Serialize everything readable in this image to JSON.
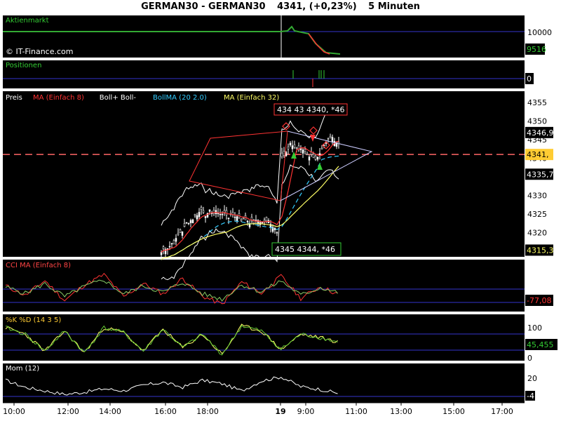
{
  "header": {
    "symbol": "GERMAN30 - GERMAN30",
    "price": "4341, (+0,23%)",
    "interval": "5 Minuten"
  },
  "panels": {
    "market": {
      "label": "Aktienmarkt",
      "copyright": "© IT-Finance.com",
      "level_label": "10000",
      "value_label": "9516"
    },
    "positions": {
      "label": "Positionen",
      "value_label": "0"
    },
    "price": {
      "legend": [
        {
          "text": "Preis",
          "color": "#ffffff"
        },
        {
          "text": "MA (Einfach 8)",
          "color": "#ff3333"
        },
        {
          "text": "Boll+ Boll-",
          "color": "#ffffff"
        },
        {
          "text": "BollMA (20 2.0)",
          "color": "#33ccff"
        },
        {
          "text": "MA (Einfach 32)",
          "color": "#ffff66"
        }
      ],
      "ticks": [
        "4355",
        "4350",
        "4345",
        "4340",
        "4335",
        "4330",
        "4325",
        "4320"
      ],
      "last_labels": [
        "4346,9",
        "4341,",
        "4335,7",
        "4315,3"
      ],
      "top_box": "434 43 4340, *46",
      "bottom_box": "4345 4344, *46"
    },
    "cci": {
      "label": "CCI MA (Einfach 8)",
      "value_label": "-77,08"
    },
    "stoch": {
      "label": "%K %D (14 3 5)",
      "ticks": [
        "100",
        "0"
      ],
      "value_label": "45,455"
    },
    "mom": {
      "label": "Mom (12)",
      "ticks": [
        "20"
      ],
      "value_label": "-4"
    }
  },
  "xaxis": {
    "labels": [
      "10:00",
      "12:00",
      "14:00",
      "16:00",
      "18:00",
      "19",
      "9:00",
      "11:00",
      "13:00",
      "15:00",
      "17:00"
    ]
  },
  "colors": {
    "background": "#000000",
    "grid_line": "#3333cc",
    "candle_up": "#ffffff",
    "ma8": "#ff3333",
    "ma32": "#ffff66",
    "bollma": "#33ccff",
    "current_line": "#ff6666",
    "market_line": "#33aa33"
  },
  "chart_data": [
    {
      "type": "line",
      "title": "Aktienmarkt",
      "series": [
        {
          "values": [
            10000,
            10000,
            10000,
            10020,
            10000,
            9516
          ]
        }
      ]
    },
    {
      "type": "line",
      "title": "Preis",
      "ylim": [
        4315,
        4357
      ],
      "series": [
        {
          "name": "Preis",
          "values": [
            4315.3,
            4322,
            4330,
            4340,
            4348,
            4342,
            4338,
            4341,
            4340,
            4338,
            4336,
            4337,
            4349,
            4344,
            4339,
            4347,
            4342,
            4341
          ]
        },
        {
          "name": "MA (Einfach 8)",
          "values": [
            4316,
            4320,
            4328,
            4336,
            4342,
            4341,
            4339,
            4340,
            4340,
            4339,
            4337,
            4338,
            4343,
            4344,
            4341,
            4344,
            4343,
            4341
          ]
        },
        {
          "name": "MA (Einfach 32)",
          "values": [
            4310,
            4313,
            4318,
            4326,
            4333,
            4337,
            4338,
            4339,
            4339,
            4339,
            4338,
            4338,
            4340,
            4341,
            4341,
            4342,
            4342,
            4341
          ]
        }
      ]
    },
    {
      "type": "line",
      "title": "CCI MA (Einfach 8)",
      "series": [
        {
          "values": [
            50,
            -80,
            120,
            -150,
            60,
            200,
            -100,
            80,
            -60,
            150,
            -90,
            -200,
            100,
            -50,
            180,
            -120,
            40,
            -77.08
          ]
        }
      ]
    },
    {
      "type": "line",
      "title": "%K %D (14 3 5)",
      "ylim": [
        0,
        100
      ],
      "series": [
        {
          "values": [
            90,
            70,
            20,
            80,
            15,
            90,
            75,
            20,
            85,
            30,
            70,
            10,
            95,
            80,
            25,
            70,
            60,
            45.455
          ]
        }
      ]
    },
    {
      "type": "line",
      "title": "Mom (12)",
      "series": [
        {
          "values": [
            15,
            5,
            0,
            -5,
            -2,
            3,
            0,
            8,
            12,
            5,
            15,
            10,
            0,
            14,
            20,
            6,
            2,
            -4
          ]
        }
      ]
    }
  ]
}
